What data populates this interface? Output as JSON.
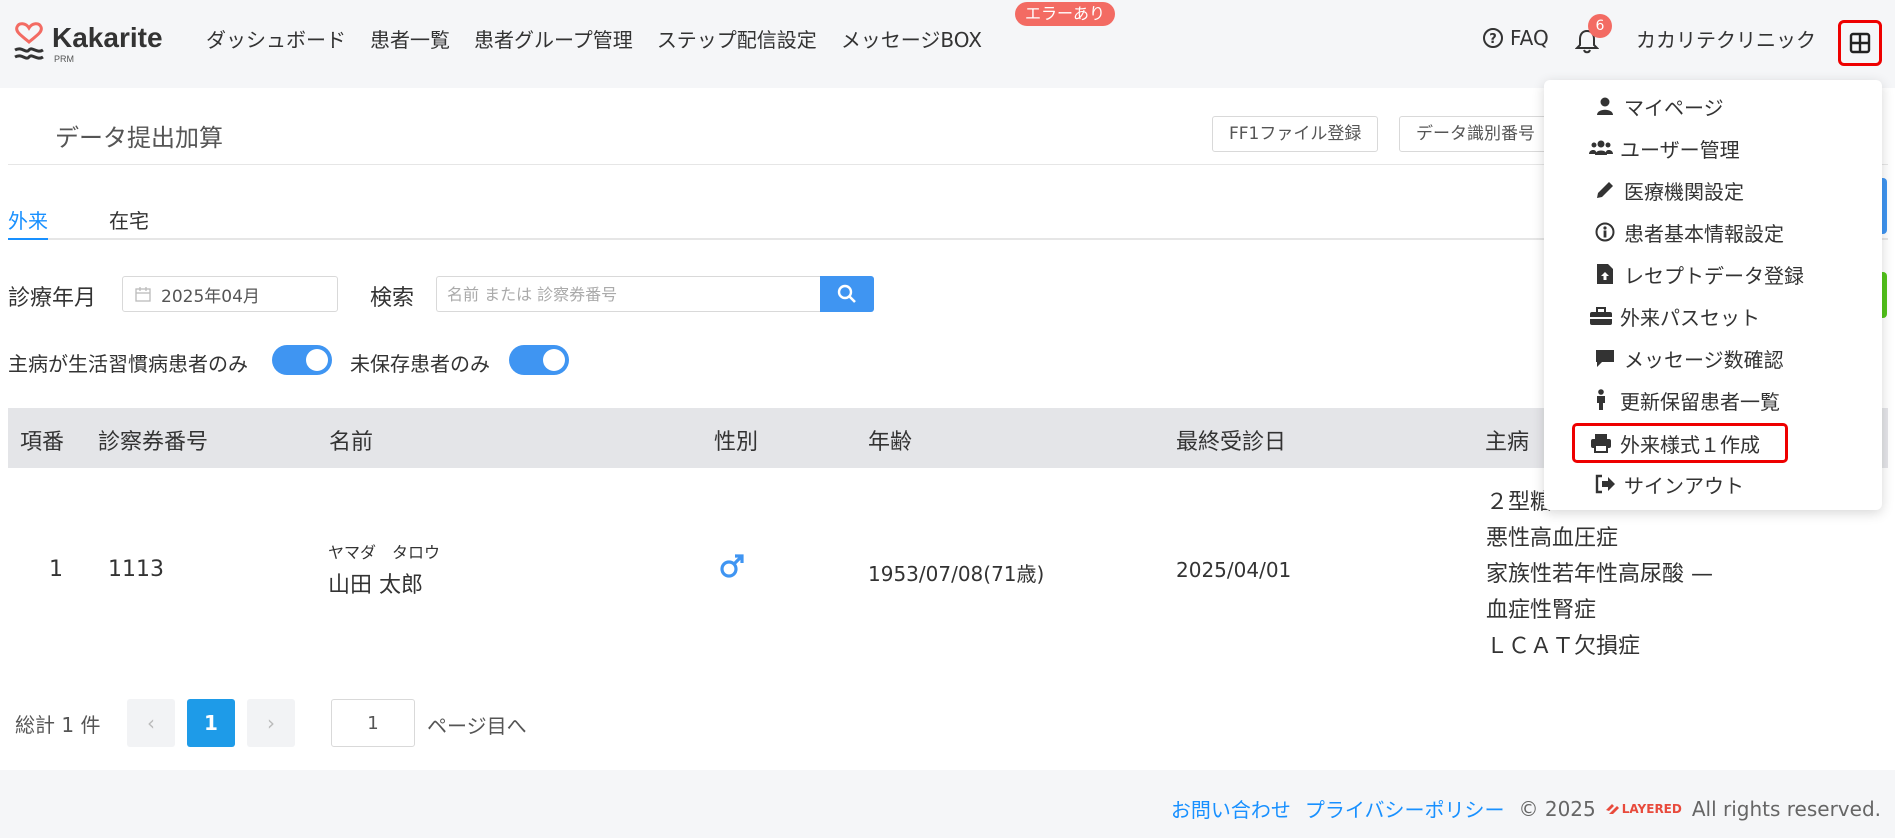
{
  "header": {
    "logo": {
      "name": "Kakarite",
      "sub": "PRM"
    },
    "nav": [
      "ダッシュボード",
      "患者一覧",
      "患者グループ管理",
      "ステップ配信設定",
      "メッセージBOX"
    ],
    "error_badge": "エラーあり",
    "faq": "FAQ",
    "notification_count": "6",
    "clinic_name": "カカリテクリニック"
  },
  "page": {
    "title": "データ提出加算",
    "buttons": [
      "FF1ファイル登録",
      "データ識別番号"
    ],
    "tabs": [
      "外来",
      "在宅"
    ],
    "filters": {
      "month_label": "診療年月",
      "month_value": "2025年04月",
      "search_label": "検索",
      "search_placeholder": "名前 または 診察券番号",
      "toggle1_label": "主病が生活習慣病患者のみ",
      "toggle2_label": "未保存患者のみ"
    },
    "table": {
      "headers": [
        "項番",
        "診察券番号",
        "名前",
        "性別",
        "年齢",
        "最終受診日",
        "主病"
      ],
      "rows": [
        {
          "no": "1",
          "card": "1113",
          "kana": "ヤマダ　タロウ",
          "name": "山田 太郎",
          "gender_icon": "male-icon",
          "age": "1953/07/08(71歳)",
          "last_visit": "2025/04/01",
          "diseases": [
            "２型糖",
            "悪性高血圧症",
            "家族性若年性高尿酸 —",
            "血症性腎症",
            "ＬＣＡＴ欠損症"
          ]
        }
      ]
    },
    "pagination": {
      "total": "総計 1 件",
      "current": "1",
      "goto_value": "1",
      "goto_label": "ページ目へ",
      "prev": "‹",
      "next": "›"
    }
  },
  "dropdown": {
    "items": [
      {
        "label": "マイページ",
        "icon": "user-icon"
      },
      {
        "label": "ユーザー管理",
        "icon": "users-icon"
      },
      {
        "label": "医療機関設定",
        "icon": "pencil-icon"
      },
      {
        "label": "患者基本情報設定",
        "icon": "info-icon"
      },
      {
        "label": "レセプトデータ登録",
        "icon": "file-upload-icon"
      },
      {
        "label": "外来パスセット",
        "icon": "toolbox-icon"
      },
      {
        "label": "メッセージ数確認",
        "icon": "message-icon"
      },
      {
        "label": "更新保留患者一覧",
        "icon": "person-icon"
      },
      {
        "label": "外来様式１作成",
        "icon": "printer-icon"
      },
      {
        "label": "サインアウト",
        "icon": "sign-out-icon"
      }
    ]
  },
  "footer": {
    "contact": "お問い合わせ",
    "privacy": "プライバシーポリシー",
    "copyright": "© 2025",
    "brand": "LAYERED",
    "rights": "All rights reserved."
  },
  "colors": {
    "accent": "#1890ff",
    "primary_button": "#3f95f2",
    "badge": "#f36b63",
    "highlight": "#ee0000"
  }
}
